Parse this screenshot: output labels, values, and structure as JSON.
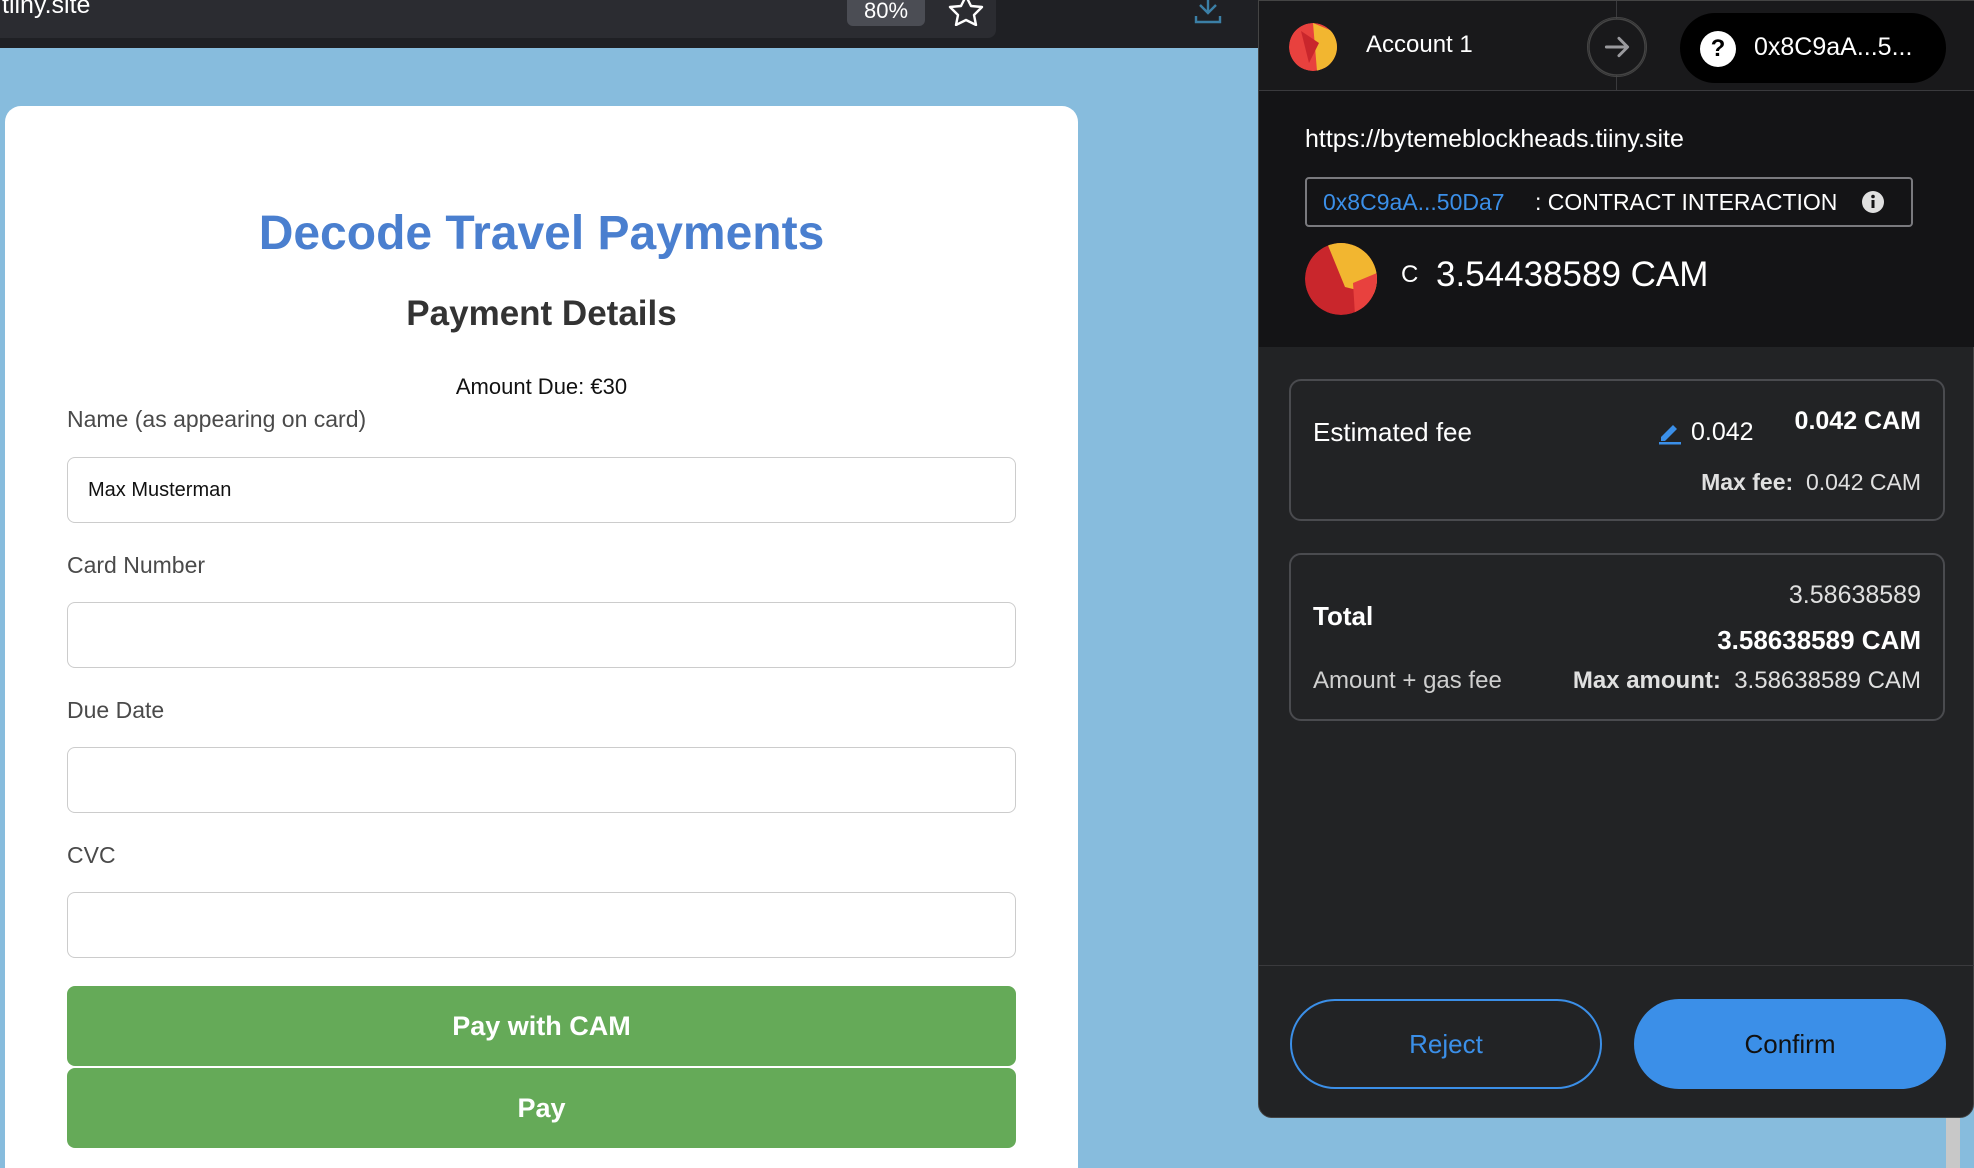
{
  "browser": {
    "url": "tiiny.site",
    "zoom": "80%",
    "icons": [
      "star-icon",
      "download-icon"
    ]
  },
  "page": {
    "title": "Decode Travel Payments",
    "section_title": "Payment Details",
    "amount_due": "Amount Due: €30",
    "fields": {
      "name_label": "Name (as appearing on card)",
      "name_value": "Max Musterman",
      "card_label": "Card Number",
      "card_value": "",
      "due_label": "Due Date",
      "due_value": "",
      "cvc_label": "CVC",
      "cvc_value": ""
    },
    "buttons": {
      "pay_cam": "Pay with CAM",
      "pay": "Pay"
    },
    "colors": {
      "title": "#4a7fcf",
      "button": "#65aa58",
      "background": "#87bcdd"
    }
  },
  "wallet": {
    "account_name": "Account 1",
    "address_short": "0x8C9aA...5...",
    "origin": "https://bytemeblockheads.tiiny.site",
    "contract_address": "0x8C9aA...50Da7",
    "contract_type": ": CONTRACT INTERACTION",
    "currency_glyph": "C",
    "amount": "3.54438589 CAM",
    "estimated_fee_label": "Estimated fee",
    "fee_small": "0.042",
    "fee_bold": "0.042 CAM",
    "max_fee_label": "Max fee:",
    "max_fee_value": "0.042 CAM",
    "total_label": "Total",
    "total_plain": "3.58638589",
    "total_bold": "3.58638589 CAM",
    "gas_note": "Amount + gas fee",
    "max_amount_label": "Max amount:",
    "max_amount_value": "3.58638589 CAM",
    "reject_label": "Reject",
    "confirm_label": "Confirm",
    "colors": {
      "accent": "#3b8fe8",
      "panel": "#222325"
    }
  }
}
